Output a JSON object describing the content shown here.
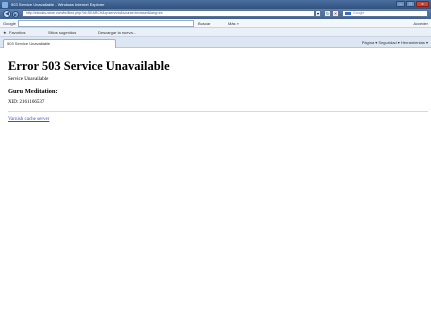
{
  "window": {
    "title": "503 Service Unavailable - Windows Internet Explorer",
    "minimize": "–",
    "maximize": "□",
    "close": "x"
  },
  "address": {
    "url": "http://ebooks-store.com/br/libro.php?id=SEARCH&q=servicio&source=browser&lang=es",
    "search_placeholder": "Google"
  },
  "google_toolbar": {
    "label": "Google",
    "buscar": "Buscar",
    "mas": "Más »",
    "acceder": "Acceder"
  },
  "favorites": {
    "favoritos": "Favoritos",
    "sitios": "Sitios sugeridos",
    "descargas": "Descargar la nueva..."
  },
  "tab": {
    "label": "503 Service Unavailable"
  },
  "commandbar": {
    "text": "Página ▾  Seguridad ▾  Herramientas ▾"
  },
  "page": {
    "heading": "Error 503 Service Unavailable",
    "subtitle": "Service Unavailable",
    "guru": "Guru Meditation:",
    "xid": "XID: 2161166537",
    "footer_link": "Varnish cache server"
  }
}
